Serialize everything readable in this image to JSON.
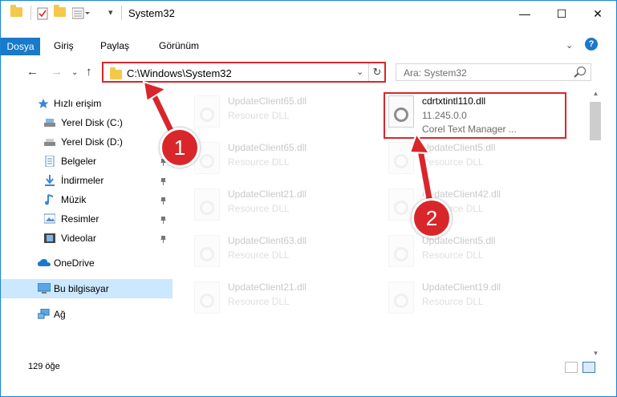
{
  "window": {
    "title": "System32",
    "minimize": "—",
    "maximize": "☐",
    "close": "✕"
  },
  "ribbon": {
    "tabs": [
      "Dosya",
      "Giriş",
      "Paylaş",
      "Görünüm"
    ],
    "help": "?"
  },
  "address": {
    "path": "C:\\Windows\\System32",
    "search_placeholder": "Ara: System32"
  },
  "nav_pane": {
    "items": [
      {
        "label": "Hızlı erişim",
        "icon": "star-icon",
        "pinned": false
      },
      {
        "label": "Yerel Disk (C:)",
        "icon": "drive-icon",
        "pinned": false
      },
      {
        "label": "Yerel Disk (D:)",
        "icon": "drive-icon",
        "pinned": false
      },
      {
        "label": "Belgeler",
        "icon": "documents-icon",
        "pinned": true
      },
      {
        "label": "İndirmeler",
        "icon": "download-icon",
        "pinned": true
      },
      {
        "label": "Müzik",
        "icon": "music-icon",
        "pinned": true
      },
      {
        "label": "Resimler",
        "icon": "pictures-icon",
        "pinned": true
      },
      {
        "label": "Videolar",
        "icon": "videos-icon",
        "pinned": true
      },
      {
        "label": "OneDrive",
        "icon": "cloud-icon",
        "pinned": false
      },
      {
        "label": "Bu bilgisayar",
        "icon": "computer-icon",
        "pinned": false,
        "selected": true
      },
      {
        "label": "Ağ",
        "icon": "network-icon",
        "pinned": false
      }
    ]
  },
  "files": {
    "highlighted": {
      "name": "cdrtxtintl110.dll",
      "version": "11.245.0.0",
      "description": "Corel Text Manager ..."
    },
    "faded": [
      {
        "name": "UpdateClient65.dll",
        "type": "Resource DLL"
      },
      {
        "name": "UpdateClient65.dll",
        "type": "Resource DLL"
      },
      {
        "name": "UpdateClient5.dll",
        "type": "Resource DLL"
      },
      {
        "name": "UpdateClient21.dll",
        "type": "Resource DLL"
      },
      {
        "name": "UpdateClient42.dll",
        "type": "Resource DLL"
      },
      {
        "name": "UpdateClient63.dll",
        "type": "Resource DLL"
      },
      {
        "name": "UpdateClient5.dll",
        "type": "Resource DLL"
      },
      {
        "name": "UpdateClient21.dll",
        "type": "Resource DLL"
      },
      {
        "name": "UpdateClient19.dll",
        "type": "Resource DLL"
      }
    ]
  },
  "status": {
    "item_count": "129 öğe"
  },
  "annotations": {
    "step1": "1",
    "step2": "2",
    "color": "#d9262b"
  }
}
